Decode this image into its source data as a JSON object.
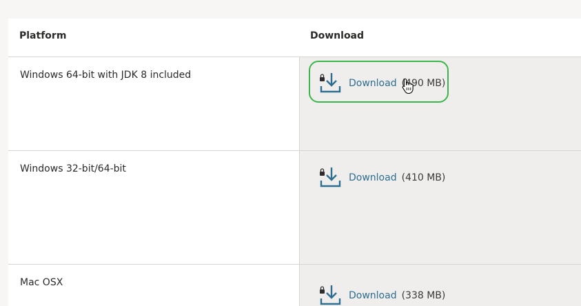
{
  "table": {
    "headers": {
      "platform": "Platform",
      "download": "Download"
    },
    "rows": [
      {
        "platform": "Windows 64-bit with JDK 8 included",
        "link_label": "Download",
        "size": "(490 MB)"
      },
      {
        "platform": "Windows 32-bit/64-bit",
        "link_label": "Download",
        "size": "(410 MB)"
      },
      {
        "platform": "Mac OSX",
        "link_label": "Download",
        "size": "(338 MB)"
      }
    ]
  },
  "colors": {
    "link": "#2d6d90",
    "highlight": "#3bb54a",
    "download_cell_bg": "#efeeec"
  },
  "icons": {
    "download": "download-lock-icon",
    "cursor": "hand-pointer-icon"
  }
}
